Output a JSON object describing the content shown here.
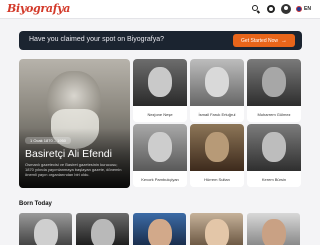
{
  "header": {
    "logo": "Biyografya",
    "language": "EN",
    "icons": [
      "search-icon",
      "theme-toggle-icon",
      "user-icon"
    ]
  },
  "banner": {
    "text": "Have you claimed your spot on Biyografya?",
    "cta_label": "Get Started Now",
    "cta_icon": "→"
  },
  "featured": {
    "dates": "1 Ocak 1870 – 1950",
    "name": "Basiretçi Ali Efendi",
    "description": "Osmanlı gazetecisi ve Basiret gazetesinin kurucusu; 1870 yılında yayımlanmaya başlayan gazete, dönemin önemli yayın organlarından biri oldu."
  },
  "people": [
    {
      "name": "Nezjone Neşe"
    },
    {
      "name": "İsmail Faruk Ertuğrul"
    },
    {
      "name": "Muharrem Gülmez"
    },
    {
      "name": "Kevork Pambukçiyan"
    },
    {
      "name": "Hürrem Sultan"
    },
    {
      "name": "Kerem Bürsin"
    }
  ],
  "born_today": {
    "title": "Born Today"
  }
}
